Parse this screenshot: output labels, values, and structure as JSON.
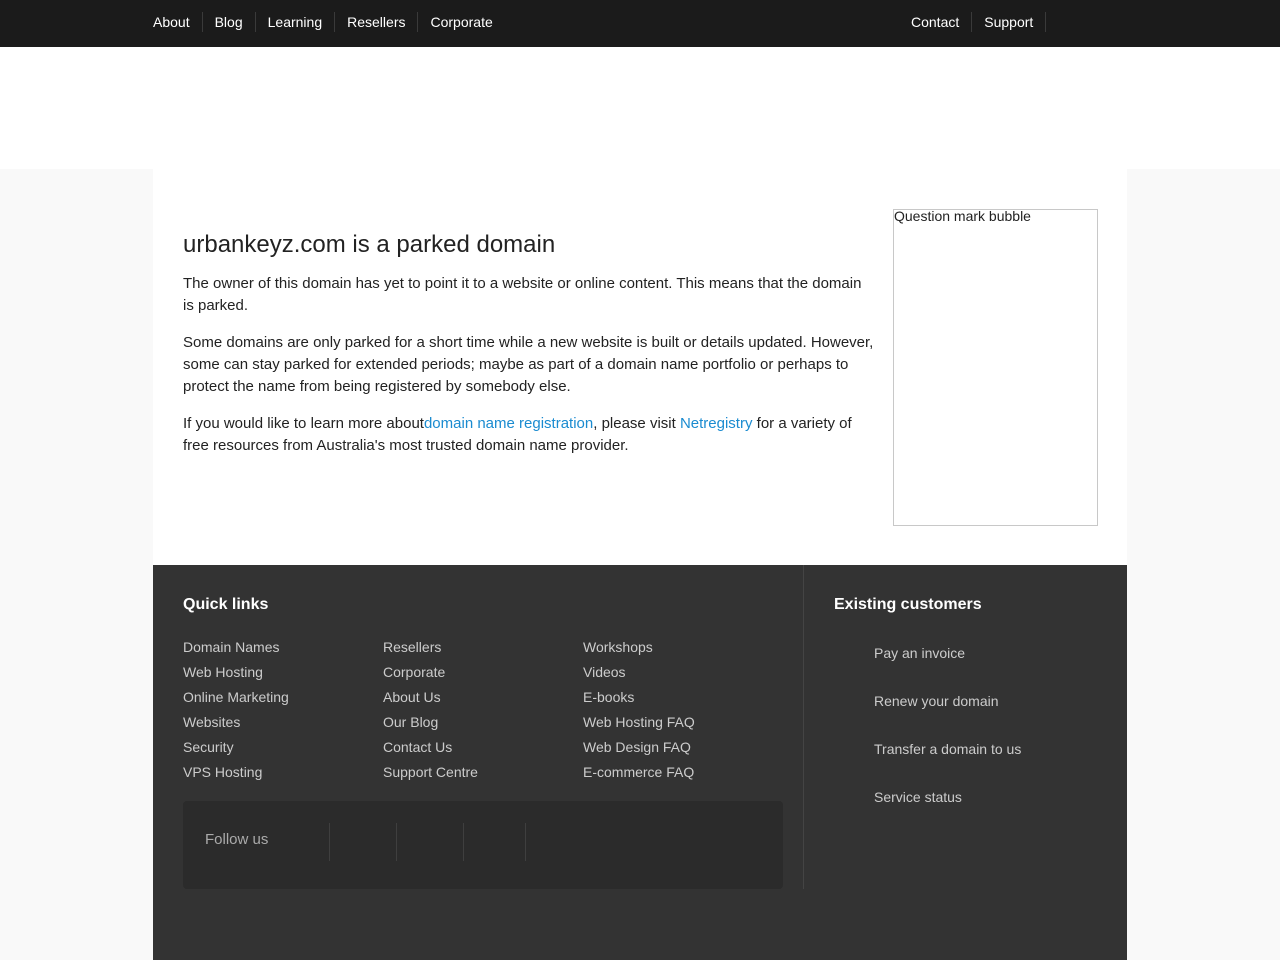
{
  "nav": {
    "left": [
      "About",
      "Blog",
      "Learning",
      "Resellers",
      "Corporate"
    ],
    "right": [
      "Contact",
      "Support"
    ]
  },
  "main": {
    "title": "urbankeyz.com is a parked domain",
    "p1": "The owner of this domain has yet to point it to a website or online content. This means that the domain is parked.",
    "p2": "Some domains are only parked for a short time while a new website is built or details updated. However, some can stay parked for extended periods; maybe as part of a domain name portfolio or perhaps to protect the name from being registered by somebody else.",
    "p3_before": "If you would like to learn more about",
    "p3_link1": "domain name registration",
    "p3_middle": ", please visit ",
    "p3_link2": "Netregistry",
    "p3_after": " for a variety of free resources from Australia's most trusted domain name provider.",
    "bubble_alt": "Question mark bubble"
  },
  "footer": {
    "quick_links_title": "Quick links",
    "col1": [
      "Domain Names",
      "Web Hosting",
      "Online Marketing",
      "Websites",
      "Security",
      "VPS Hosting"
    ],
    "col2": [
      "Resellers",
      "Corporate",
      "About Us",
      "Our Blog",
      "Contact Us",
      "Support Centre"
    ],
    "col3": [
      "Workshops",
      "Videos",
      "E-books",
      "Web Hosting FAQ",
      "Web Design FAQ",
      "E-commerce FAQ"
    ],
    "follow_label": "Follow us",
    "existing_title": "Existing customers",
    "existing": [
      "Pay an invoice",
      "Renew your domain",
      "Transfer a domain to us",
      "Service status"
    ]
  }
}
